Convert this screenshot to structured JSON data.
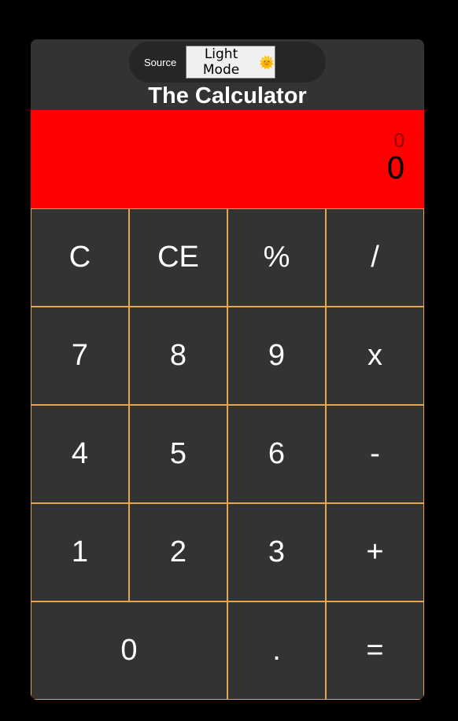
{
  "header": {
    "source_label": "Source",
    "mode_button_label": "Light Mode",
    "mode_button_emoji": "🌞",
    "title": "The Calculator"
  },
  "display": {
    "previous": "0",
    "current": "0",
    "background_color": "#ff0000"
  },
  "keypad": {
    "rows": [
      [
        {
          "label": "C",
          "name": "clear-button"
        },
        {
          "label": "CE",
          "name": "clear-entry-button"
        },
        {
          "label": "%",
          "name": "percent-button"
        },
        {
          "label": "/",
          "name": "divide-button"
        }
      ],
      [
        {
          "label": "7",
          "name": "digit-7-button"
        },
        {
          "label": "8",
          "name": "digit-8-button"
        },
        {
          "label": "9",
          "name": "digit-9-button"
        },
        {
          "label": "x",
          "name": "multiply-button"
        }
      ],
      [
        {
          "label": "4",
          "name": "digit-4-button"
        },
        {
          "label": "5",
          "name": "digit-5-button"
        },
        {
          "label": "6",
          "name": "digit-6-button"
        },
        {
          "label": "-",
          "name": "subtract-button"
        }
      ],
      [
        {
          "label": "1",
          "name": "digit-1-button"
        },
        {
          "label": "2",
          "name": "digit-2-button"
        },
        {
          "label": "3",
          "name": "digit-3-button"
        },
        {
          "label": "+",
          "name": "add-button"
        }
      ],
      [
        {
          "label": "0",
          "name": "digit-0-button",
          "wide": true
        },
        {
          "label": ".",
          "name": "decimal-button"
        },
        {
          "label": "=",
          "name": "equals-button"
        }
      ]
    ]
  },
  "colors": {
    "page_background": "#000000",
    "calculator_body": "#333333",
    "key_border": "#e8a64c",
    "display": "#ff0000"
  }
}
